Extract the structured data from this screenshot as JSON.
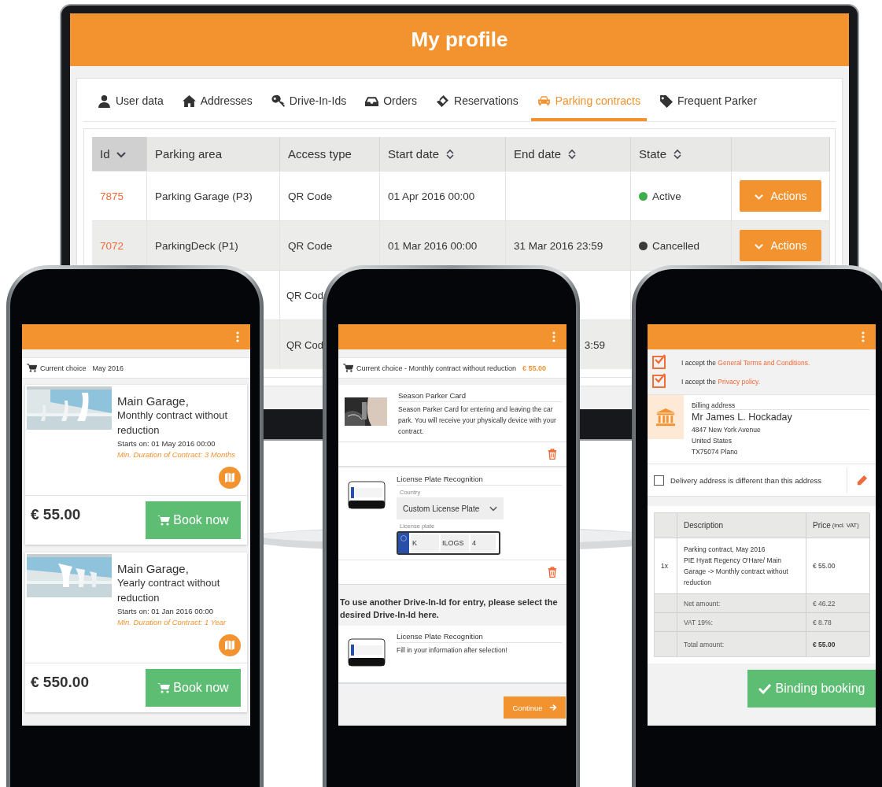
{
  "monitor": {
    "title": "My profile",
    "tabs": [
      {
        "label": "User data",
        "selected": false
      },
      {
        "label": "Addresses",
        "selected": false
      },
      {
        "label": "Drive-In-Ids",
        "selected": false
      },
      {
        "label": "Orders",
        "selected": false
      },
      {
        "label": "Reservations",
        "selected": false
      },
      {
        "label": "Parking contracts",
        "selected": true
      },
      {
        "label": "Frequent Parker",
        "selected": false
      }
    ],
    "table": {
      "columns": [
        {
          "label": "Id",
          "sorted": true,
          "sortable": true
        },
        {
          "label": "Parking area",
          "sorted": false,
          "sortable": false
        },
        {
          "label": "Access type",
          "sorted": false,
          "sortable": false
        },
        {
          "label": "Start date",
          "sorted": false,
          "sortable": true
        },
        {
          "label": "End date",
          "sorted": false,
          "sortable": true
        },
        {
          "label": "State",
          "sorted": false,
          "sortable": true
        }
      ],
      "rows": [
        {
          "id": "7875",
          "parking_area": "Parking Garage (P3)",
          "access_type": "QR Code",
          "start_date": "01 Apr 2016 00:00",
          "state": "Active",
          "color": "#3fae49",
          "action": "Actions"
        },
        {
          "id": "7072",
          "parking_area": "ParkingDeck (P1)",
          "access_type": "QR Code",
          "start_date": "01 Mar 2016 00:00",
          "end_date": "31 Mar 2016 23:59",
          "state": "Cancelled",
          "color": "#3a3a3a",
          "action": "Actions"
        },
        {
          "access_type": "QR Cod"
        },
        {
          "access_type": "QR Cod",
          "end_date": "3:59"
        }
      ]
    }
  },
  "offers_screen": {
    "current_choice": {
      "label": "Current choice",
      "value": "May 2016"
    },
    "offers": [
      {
        "title": "Main Garage,",
        "subtitle": "Monthly contract without reduction",
        "starts": "Starts on: 01 May 2016 00:00",
        "min_duration": "Min. Duration of Contract: 3 Months",
        "price": "€ 55.00",
        "button": "Book now"
      },
      {
        "title": "Main Garage,",
        "subtitle": "Yearly contract without reduction",
        "starts": "Starts on: 01 Jan 2016 00:00",
        "min_duration": "Min. Duration of Contract: 1 Year",
        "price": "€ 550.00",
        "button": "Book now"
      }
    ]
  },
  "drive_in_screen": {
    "current_choice": {
      "label": "Current choice - Monthly contract without reduction",
      "price": "€ 55.00"
    },
    "season_card": {
      "title": "Season Parker Card",
      "description": "Season Parker Card for entering and leaving the car park. You will receive your physically device with your contract."
    },
    "plate_item": {
      "title": "License Plate Recognition",
      "country_label": "Country",
      "country_value": "Custom License Plate",
      "plate_label": "License plate",
      "plate_parts": [
        "K",
        "ILOGS",
        "4"
      ]
    },
    "notice": "To use another Drive-In-Id for entry, please select the desired Drive-In-Id here.",
    "option": {
      "title": "License Plate Recognition",
      "description": "Fill in your information after selection!"
    },
    "button": "Continue"
  },
  "checkout_screen": {
    "consents": [
      {
        "text": "I accept the",
        "link": "General Terms and Conditions.",
        "checked": true
      },
      {
        "text": "I accept the",
        "link": "Privacy policy.",
        "checked": true
      }
    ],
    "billing": {
      "label": "Billing address",
      "name": "Mr James L. Hockaday",
      "lines": [
        "4847 New York Avenue",
        "United States",
        "TX75074 Plano"
      ]
    },
    "delivery": {
      "label": "Delivery address is different than this address",
      "checked": false
    },
    "table": {
      "description_header": "Description",
      "price_header": "Price",
      "price_note": "(incl. VAT)",
      "items": [
        {
          "quantity": "1x",
          "lines": [
            "Parking contract, May 2016",
            "PIE Hyatt Regency O'Hare/ Main Garage -> Monthly contract without reduction"
          ],
          "price": "€ 55.00"
        }
      ],
      "summary": [
        {
          "label": "Net amount:",
          "value": "€ 46.22",
          "kind": "subtotal"
        },
        {
          "label": "VAT 19%:",
          "value": "€ 8.78",
          "kind": "subtotal"
        },
        {
          "label": "Total amount:",
          "value": "€ 55.00",
          "kind": "total"
        }
      ]
    },
    "button": "Binding booking"
  }
}
